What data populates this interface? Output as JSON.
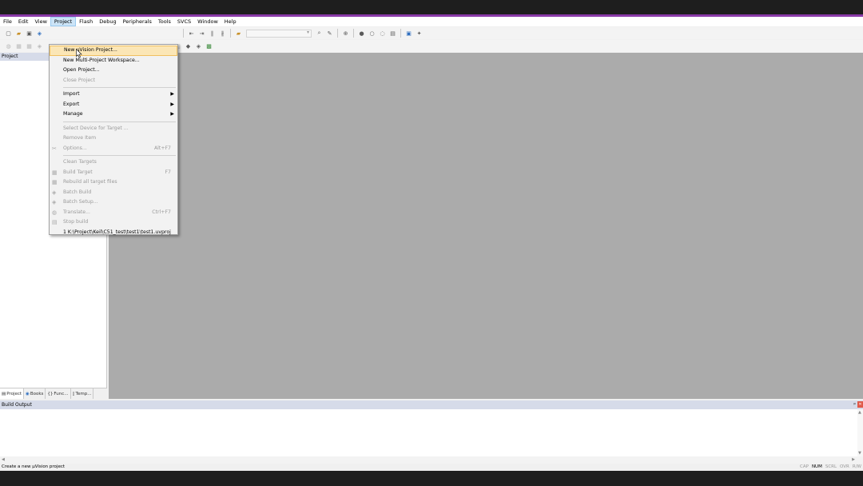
{
  "menubar": {
    "items": [
      "File",
      "Edit",
      "View",
      "Project",
      "Flash",
      "Debug",
      "Peripherals",
      "Tools",
      "SVCS",
      "Window",
      "Help"
    ]
  },
  "project_panel": {
    "title": "Project",
    "tabs": [
      "Project",
      "Books",
      "Func...",
      "Temp..."
    ]
  },
  "project_menu": {
    "new_uvision_project": "New µVision Project...",
    "new_multi_project_workspace": "New Multi-Project Workspace...",
    "open_project": "Open Project...",
    "close_project": "Close Project",
    "import": "Import",
    "export": "Export",
    "manage": "Manage",
    "select_device": "Select Device for Target ...",
    "remove_item": "Remove Item",
    "options": "Options...",
    "options_shortcut": "Alt+F7",
    "clean_targets": "Clean Targets",
    "build_target": "Build Target",
    "build_target_shortcut": "F7",
    "rebuild_all": "Rebuild all target files",
    "batch_build": "Batch Build",
    "batch_setup": "Batch Setup...",
    "translate": "Translate...",
    "translate_shortcut": "Ctrl+F7",
    "stop_build": "Stop build",
    "recent_1": "1 K:\\Project\\Keil\\C51_test\\test1\\test1.uvproj"
  },
  "build_output": {
    "title": "Build Output",
    "pin": "ᵖ",
    "close": "✕"
  },
  "statusbar": {
    "text": "Create a new µVision project",
    "indicators": [
      "CAP",
      "NUM",
      "SCRL",
      "OVR",
      "R/W"
    ]
  },
  "icons": {
    "new_file": "🗋",
    "open": "📂",
    "save": "💾",
    "save_all": "🗐",
    "submenu_arrow": "▶",
    "options": "✂",
    "build": "▦"
  },
  "colors": {
    "accent": "#8a3aa8",
    "editor_bg": "#ababab",
    "menu_highlight": "#fbe6b6",
    "panel_header": "#d6dbe9"
  }
}
